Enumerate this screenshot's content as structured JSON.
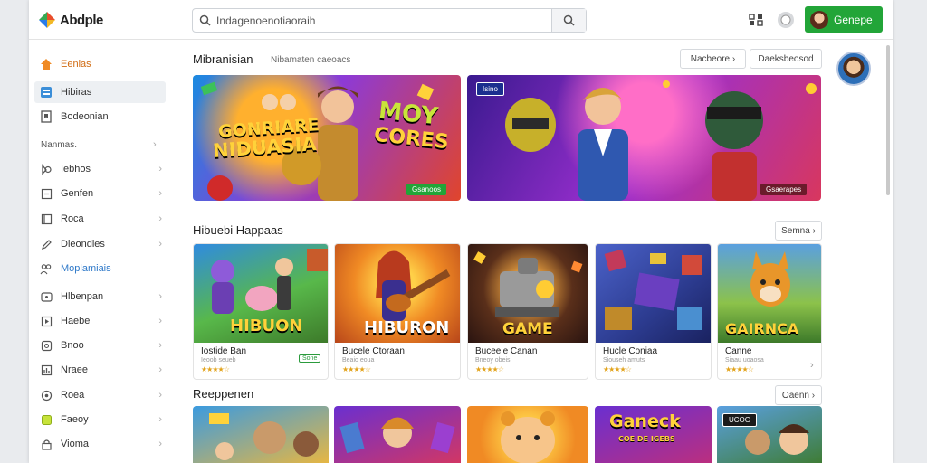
{
  "app": {
    "logo_text": "Abdple"
  },
  "search": {
    "value": "Indagenoenotiaoraih"
  },
  "header": {
    "get_button_label": "Genepe"
  },
  "sidebar": {
    "top_items": [
      {
        "label": "Eenias",
        "icon": "home-icon"
      },
      {
        "label": "Hibiras",
        "icon": "grid-icon",
        "active": true
      },
      {
        "label": "Bodeonian",
        "icon": "bookmark-icon"
      }
    ],
    "heading": "Nanmas.",
    "middle_items": [
      {
        "label": "Iebhos",
        "icon": "clock-icon"
      },
      {
        "label": "Genfen",
        "icon": "gamepad-icon"
      },
      {
        "label": "Roca",
        "icon": "list-icon"
      },
      {
        "label": "Dleondies",
        "icon": "pencil-icon"
      },
      {
        "label": "Moplamiais",
        "icon": "people-icon",
        "highlight": true
      }
    ],
    "bottom_items": [
      {
        "label": "Hlbenpan",
        "icon": "tv-icon"
      },
      {
        "label": "Haebe",
        "icon": "play-icon"
      },
      {
        "label": "Bnoo",
        "icon": "doc-icon"
      },
      {
        "label": "Nraee",
        "icon": "chart-icon"
      },
      {
        "label": "Roea",
        "icon": "circle-icon"
      },
      {
        "label": "Faeoy",
        "icon": "green-square-icon"
      },
      {
        "label": "Vioma",
        "icon": "lock-icon"
      }
    ]
  },
  "featured": {
    "title": "Mibranisian",
    "subtitle": "Nibamaten caeoacs",
    "pill_left": "Nacbeore",
    "pill_right": "Daeksbeosod",
    "banners": [
      {
        "art_text_1": "GONRIARE",
        "art_text_2": "NIDUASIA",
        "art_text_3": "MOY",
        "art_text_4": "CORES",
        "tag": "Gsanoos"
      },
      {
        "corner_tag": "Isino",
        "tag": "Gsaerapes"
      }
    ]
  },
  "happenings": {
    "title": "Hibuebi Happaas",
    "pill": "Semna",
    "cards": [
      {
        "art_text": "HIBUON",
        "title": "Iostide Ban",
        "sub": "Ieoob seueb",
        "stars": "★★★★☆",
        "badge": "Sone"
      },
      {
        "art_text": "HIBURON",
        "title": "Bucele Ctoraan",
        "sub": "Beaio eoua",
        "stars": "★★★★☆"
      },
      {
        "art_text": "GAME",
        "title": "Buceele Canan",
        "sub": "Bneoy obeis",
        "stars": "★★★★☆"
      },
      {
        "title": "Hucle Coniaa",
        "sub": "Siouseh amuts",
        "stars": "★★★★☆"
      },
      {
        "art_text": "GAIRNCA",
        "title": "Canne",
        "sub": "Siaau uoaosa",
        "stars": "★★★★☆"
      }
    ]
  },
  "recommended": {
    "title": "Reeppenen",
    "pill": "Oaenn",
    "cards": [
      {
        "art_text": ""
      },
      {
        "art_text": ""
      },
      {
        "art_text": ""
      },
      {
        "art_text": "Ganeck",
        "art_sub": "COE DE IGEBS"
      },
      {
        "corner_tag": "UCOG"
      }
    ]
  },
  "colors": {
    "accent_green": "#22a538",
    "star": "#e2a31b",
    "active_bg": "#edf0f3"
  }
}
